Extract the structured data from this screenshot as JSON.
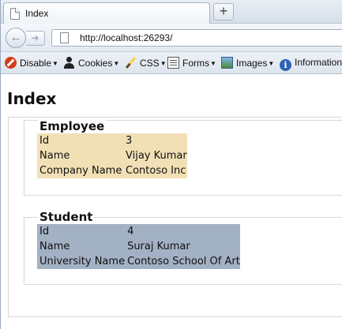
{
  "browser": {
    "tab_title": "Index",
    "new_tab_label": "+",
    "url": "http://localhost:26293/"
  },
  "toolbar": {
    "items": [
      {
        "label": "Disable",
        "icon": "disable-icon"
      },
      {
        "label": "Cookies",
        "icon": "cookies-icon"
      },
      {
        "label": "CSS",
        "icon": "css-icon"
      },
      {
        "label": "Forms",
        "icon": "forms-icon"
      },
      {
        "label": "Images",
        "icon": "images-icon"
      },
      {
        "label": "Information",
        "icon": "info-icon"
      }
    ]
  },
  "page": {
    "title": "Index",
    "employee": {
      "legend": "Employee",
      "rows": [
        {
          "label": "Id",
          "value": "3"
        },
        {
          "label": "Name",
          "value": "Vijay Kumar"
        },
        {
          "label": "Company Name",
          "value": "Contoso Inc"
        }
      ]
    },
    "student": {
      "legend": "Student",
      "rows": [
        {
          "label": "Id",
          "value": "4"
        },
        {
          "label": "Name",
          "value": "Suraj Kumar"
        },
        {
          "label": "University Name",
          "value": "Contoso School Of Art"
        }
      ]
    }
  },
  "colors": {
    "employee_bg": "#f1e0b6",
    "student_bg": "#a3b1c4"
  }
}
